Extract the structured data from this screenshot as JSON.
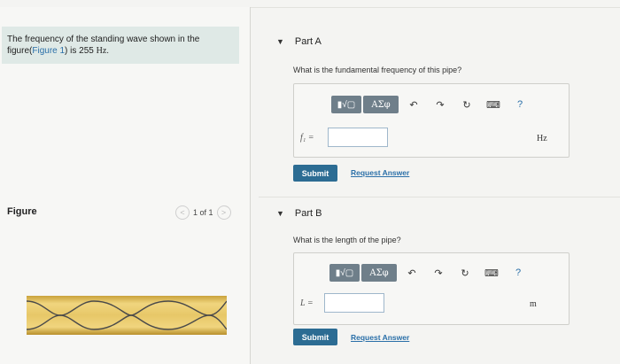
{
  "problem": {
    "text_before": "The frequency of the standing wave shown in the figure(",
    "figure_link": "Figure 1",
    "text_after": ") is 255 ",
    "unit": "Hz",
    "end": "."
  },
  "figure": {
    "label": "Figure",
    "pager": {
      "prev": "<",
      "text": "1 of 1",
      "next": ">"
    }
  },
  "partA": {
    "toggle": "▼",
    "title": "Part A",
    "question": "What is the fundamental frequency of this pipe?",
    "variable": "f₁ =",
    "unit": "Hz",
    "submit": "Submit",
    "request": "Request Answer"
  },
  "partB": {
    "toggle": "▼",
    "title": "Part B",
    "question": "What is the length of the pipe?",
    "variable": "L =",
    "unit": "m",
    "submit": "Submit",
    "request": "Request Answer"
  },
  "toolbar": {
    "templates_glyph": "▮√▢",
    "greek": "ΑΣφ",
    "undo": "↶",
    "redo": "↷",
    "reset": "↻",
    "keyboard": "⌨",
    "help": "?"
  },
  "colors": {
    "accent": "#2c6c93",
    "link": "#2a6fa8",
    "toolbar": "#6f7f8a",
    "problem_bg": "#dfe9e6",
    "tube": "#e4c46a"
  }
}
